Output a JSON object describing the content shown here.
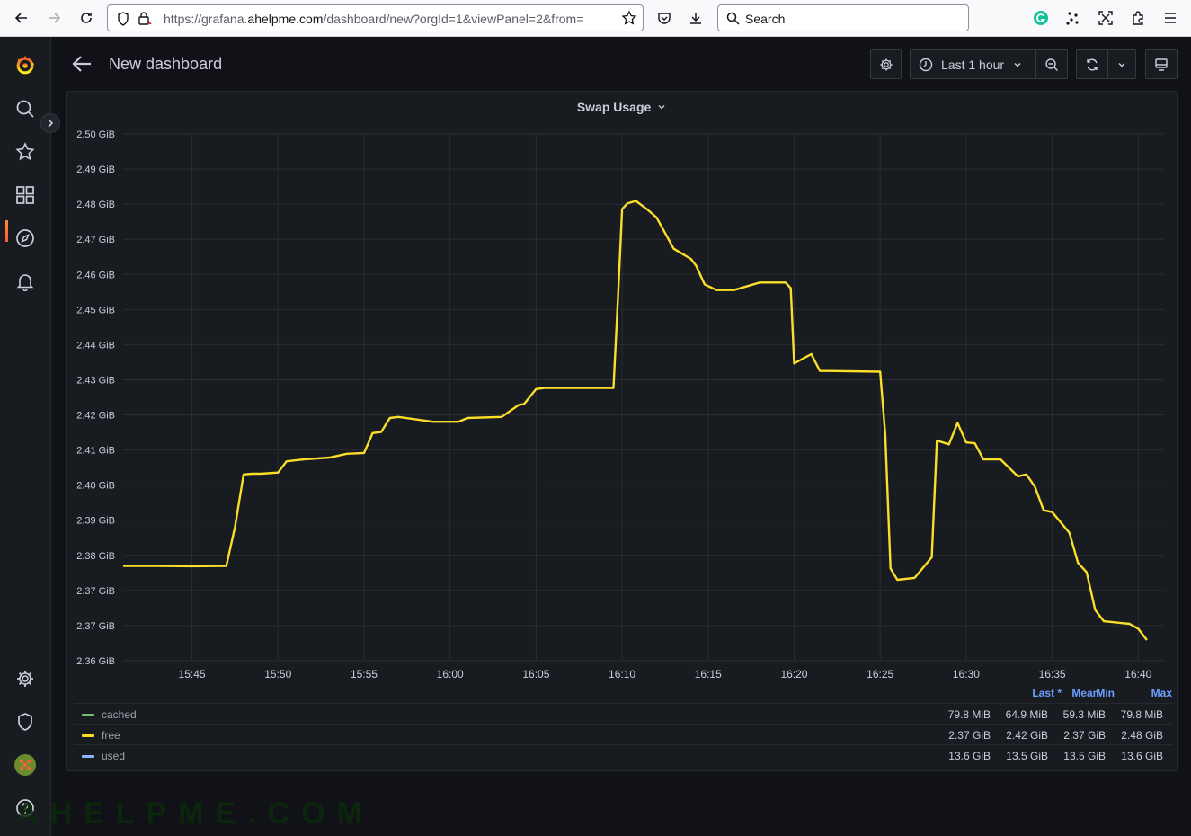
{
  "browser": {
    "url_prefix": "https://grafana.",
    "url_domain": "ahelpme.com",
    "url_suffix": "/dashboard/new?orgId=1&viewPanel=2&from=",
    "search_placeholder": "Search"
  },
  "sidebar": {
    "items": [
      "grafana-logo-icon",
      "search-icon",
      "star-icon",
      "dashboards-icon",
      "explore-icon",
      "alerting-icon",
      "gear-icon",
      "shield-icon",
      "avatar",
      "help-icon"
    ]
  },
  "header": {
    "title": "New dashboard",
    "time_range": "Last 1 hour"
  },
  "panel": {
    "title": "Swap Usage"
  },
  "chart_data": {
    "type": "line",
    "title": "Swap Usage",
    "y_tick_labels": [
      "2.36 GiB",
      "2.37 GiB",
      "2.37 GiB",
      "2.38 GiB",
      "2.39 GiB",
      "2.40 GiB",
      "2.41 GiB",
      "2.42 GiB",
      "2.43 GiB",
      "2.44 GiB",
      "2.45 GiB",
      "2.46 GiB",
      "2.47 GiB",
      "2.48 GiB",
      "2.49 GiB",
      "2.50 GiB"
    ],
    "x_tick_labels": [
      "15:45",
      "15:50",
      "15:55",
      "16:00",
      "16:05",
      "16:10",
      "16:15",
      "16:20",
      "16:25",
      "16:30",
      "16:35",
      "16:40"
    ],
    "ylim": [
      2.36,
      2.5
    ],
    "grid": true,
    "series": [
      {
        "name": "free",
        "color": "#fade2a",
        "x": [
          "15:41",
          "15:43",
          "15:45",
          "15:47",
          "15:47.5",
          "15:48",
          "15:48.5",
          "15:49",
          "15:50",
          "15:50.5",
          "15:51.5",
          "15:53",
          "15:54",
          "15:55",
          "15:55.5",
          "15:56",
          "15:56.5",
          "15:57",
          "15:59",
          "16:00.5",
          "16:01",
          "16:03",
          "16:04",
          "16:04.3",
          "16:05",
          "16:05.5",
          "16:06",
          "16:09.5",
          "16:09.8",
          "16:10",
          "16:10.3",
          "16:10.8",
          "16:11.5",
          "16:12",
          "16:13",
          "16:14",
          "16:14.3",
          "16:14.8",
          "16:15.5",
          "16:16",
          "16:16.5",
          "16:18",
          "16:19.5",
          "16:19.8",
          "16:20",
          "16:21",
          "16:21.5",
          "16:22",
          "16:25",
          "16:25.3",
          "16:25.6",
          "16:26",
          "16:27",
          "16:28",
          "16:28.3",
          "16:29",
          "16:29.5",
          "16:30",
          "16:30.5",
          "16:31",
          "16:32",
          "16:33",
          "16:33.5",
          "16:34",
          "16:34.5",
          "16:35",
          "16:36",
          "16:36.5",
          "16:37",
          "16:37.5",
          "16:38",
          "16:39",
          "16:39.5",
          "16:40",
          "16:40.5"
        ],
        "y": [
          2.3852,
          2.3852,
          2.3851,
          2.3852,
          2.3955,
          2.4095,
          2.4097,
          2.4097,
          2.41,
          2.413,
          2.4135,
          2.414,
          2.415,
          2.4152,
          2.4205,
          2.4208,
          2.4245,
          2.4248,
          2.4235,
          2.4235,
          2.4245,
          2.4248,
          2.428,
          2.4282,
          2.4322,
          2.4325,
          2.4325,
          2.4325,
          2.46,
          2.48,
          2.4815,
          2.4822,
          2.4798,
          2.4778,
          2.4695,
          2.4668,
          2.465,
          2.46,
          2.4585,
          2.4585,
          2.4585,
          2.4605,
          2.4605,
          2.459,
          2.439,
          2.4415,
          2.437,
          2.437,
          2.4368,
          2.42,
          2.3845,
          2.3815,
          2.382,
          2.3875,
          2.4185,
          2.4175,
          2.4232,
          2.418,
          2.4178,
          2.4135,
          2.4135,
          2.409,
          2.4095,
          2.4062,
          2.4,
          2.3995,
          2.394,
          2.386,
          2.3835,
          2.3735,
          2.3705,
          2.37,
          2.3698,
          2.3685,
          2.3655
        ]
      },
      {
        "name": "cached",
        "color": "#73bf69",
        "x": [],
        "y": []
      },
      {
        "name": "used",
        "color": "#8ab8ff",
        "x": [],
        "y": []
      }
    ],
    "legend": {
      "placement": "bottom",
      "columns": [
        "Last *",
        "Mean",
        "Min",
        "Max"
      ],
      "rows": [
        {
          "name": "cached",
          "color": "#73bf69",
          "values": [
            "79.8 MiB",
            "64.9 MiB",
            "59.3 MiB",
            "79.8 MiB"
          ]
        },
        {
          "name": "free",
          "color": "#fade2a",
          "values": [
            "2.37 GiB",
            "2.42 GiB",
            "2.37 GiB",
            "2.48 GiB"
          ]
        },
        {
          "name": "used",
          "color": "#8ab8ff",
          "values": [
            "13.6 GiB",
            "13.5 GiB",
            "13.5 GiB",
            "13.6 GiB"
          ]
        }
      ]
    }
  },
  "watermark": "AHELPME.COM"
}
